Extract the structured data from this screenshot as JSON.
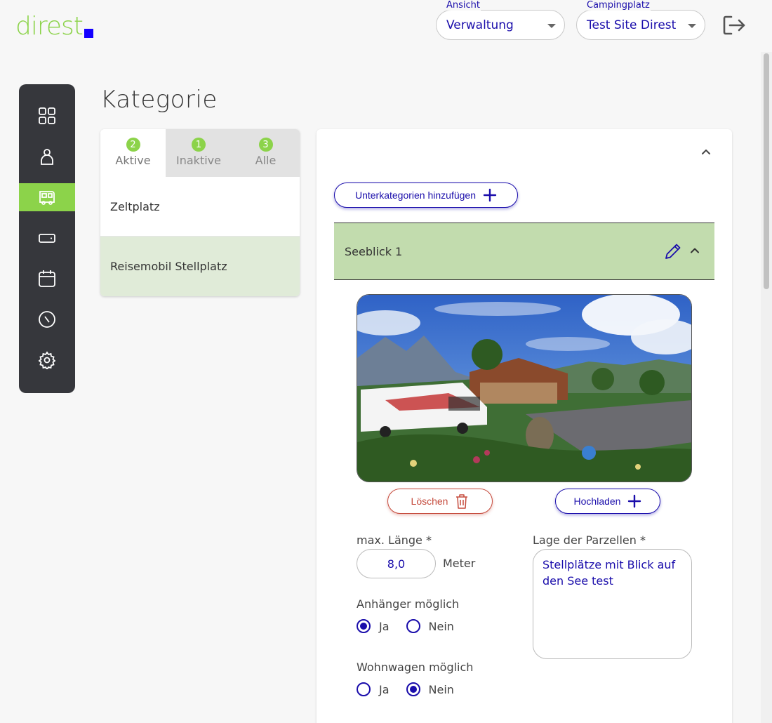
{
  "brand": {
    "name": "direst",
    "text_color": "#8cd34a",
    "square_color": "#1400ff"
  },
  "header": {
    "view_select": {
      "label": "Ansicht",
      "value": "Verwaltung"
    },
    "site_select": {
      "label": "Campingplatz",
      "value": "Test Site Direst"
    },
    "logout_icon": "logout-icon"
  },
  "sidebar": {
    "items": [
      {
        "icon": "dashboard-grid-icon",
        "active": false
      },
      {
        "icon": "person-icon",
        "active": false
      },
      {
        "icon": "camper-van-icon",
        "active": true
      },
      {
        "icon": "wallet-icon",
        "active": false
      },
      {
        "icon": "calendar-icon",
        "active": false
      },
      {
        "icon": "compass-icon",
        "active": false
      },
      {
        "icon": "gear-icon",
        "active": false
      }
    ],
    "active_color": "#8cd34a"
  },
  "page": {
    "title": "Kategorie"
  },
  "category_tabs": [
    {
      "label": "Aktive",
      "count": "2",
      "active": true
    },
    {
      "label": "Inaktive",
      "count": "1",
      "active": false
    },
    {
      "label": "Alle",
      "count": "3",
      "active": false
    }
  ],
  "categories": [
    {
      "label": "Zeltplatz",
      "selected": false
    },
    {
      "label": "Reisemobil Stellplatz",
      "selected": true
    }
  ],
  "detail": {
    "add_subcategory_label": "Unterkategorien hinzufügen",
    "subcategory": {
      "name": "Seeblick 1"
    },
    "delete_label": "Löschen",
    "upload_label": "Hochladen",
    "max_length": {
      "label": "max. Länge *",
      "value": "8,0",
      "unit": "Meter"
    },
    "location": {
      "label": "Lage der Parzellen *",
      "value": "Stellplätze mit Blick auf den See test"
    },
    "trailer": {
      "label": "Anhänger möglich",
      "yes": "Ja",
      "no": "Nein",
      "selected": "Ja"
    },
    "caravan": {
      "label": "Wohnwagen möglich",
      "yes": "Ja",
      "no": "Nein",
      "selected": "Nein"
    }
  },
  "colors": {
    "primary": "#1a0dab",
    "accent_green": "#8cd34a",
    "danger": "#c54a3c",
    "selected_row": "#e0ebd8",
    "subcategory_bg": "#c2dcae"
  }
}
